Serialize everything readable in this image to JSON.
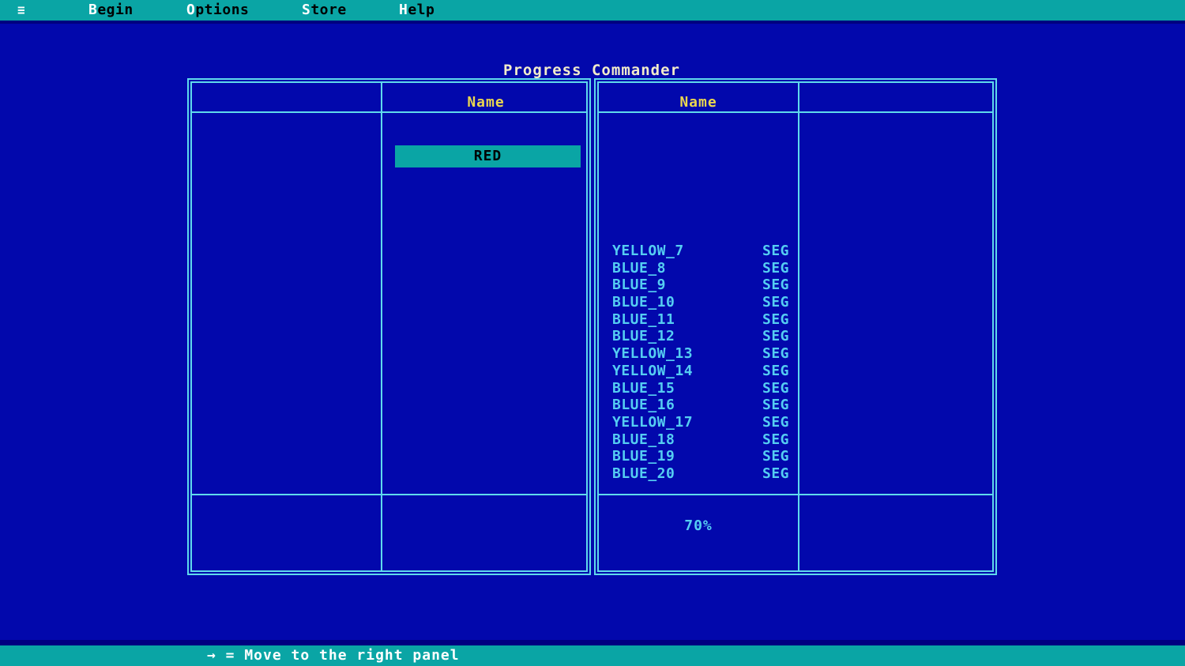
{
  "title": "Progress Commander",
  "menu_bar": {
    "hamburger": "≡",
    "items": [
      {
        "label": "Begin",
        "hotkey": "B",
        "rest": "egin"
      },
      {
        "label": "Options",
        "hotkey": "O",
        "rest": "ptions"
      },
      {
        "label": "Store",
        "hotkey": "S",
        "rest": "tore"
      },
      {
        "label": "Help",
        "hotkey": "H",
        "rest": "elp"
      }
    ]
  },
  "left_panel": {
    "header": "Name",
    "selected_item": "RED"
  },
  "right_panel": {
    "header": "Name",
    "items": [
      {
        "name": "YELLOW_7",
        "ext": "SEG"
      },
      {
        "name": "BLUE_8",
        "ext": "SEG"
      },
      {
        "name": "BLUE_9",
        "ext": "SEG"
      },
      {
        "name": "BLUE_10",
        "ext": "SEG"
      },
      {
        "name": "BLUE_11",
        "ext": "SEG"
      },
      {
        "name": "BLUE_12",
        "ext": "SEG"
      },
      {
        "name": "YELLOW_13",
        "ext": "SEG"
      },
      {
        "name": "YELLOW_14",
        "ext": "SEG"
      },
      {
        "name": "BLUE_15",
        "ext": "SEG"
      },
      {
        "name": "BLUE_16",
        "ext": "SEG"
      },
      {
        "name": "YELLOW_17",
        "ext": "SEG"
      },
      {
        "name": "BLUE_18",
        "ext": "SEG"
      },
      {
        "name": "BLUE_19",
        "ext": "SEG"
      },
      {
        "name": "BLUE_20",
        "ext": "SEG"
      }
    ],
    "status": "70%"
  },
  "status_bar": {
    "text": "→ = Move to the right panel"
  },
  "colors": {
    "background_blue": "#0208ac",
    "bar_teal": "#0aa5a5",
    "border_cyan": "#5fd9ec",
    "file_text_cyan": "#55cdf2",
    "header_yellow": "#e9d64f",
    "title_cream": "#f2ecca",
    "shadow_navy": "#000080",
    "selected_text": "#000000",
    "menu_hotkey_white": "#ffffff"
  }
}
